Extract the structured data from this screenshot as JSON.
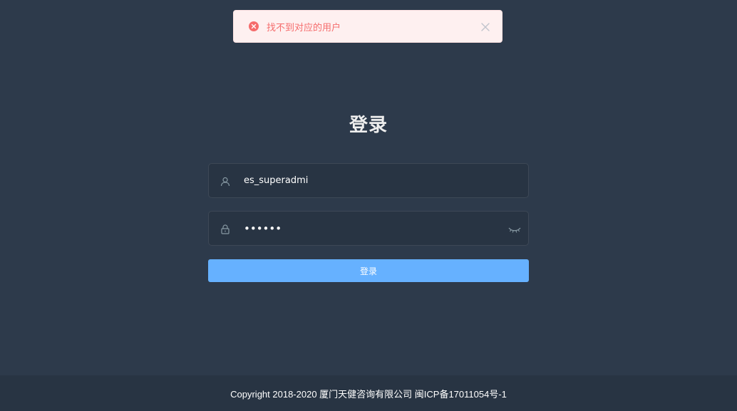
{
  "toast": {
    "type": "error",
    "message": "找不到对应的用户",
    "icon": "error-circle-icon",
    "close_icon": "close-icon"
  },
  "login": {
    "title": "登录",
    "username": {
      "value": "es_superadmi",
      "icon": "user-icon"
    },
    "password": {
      "value": "••••••",
      "icon": "lock-icon",
      "toggle_icon": "eye-closed-icon"
    },
    "submit_label": "登录"
  },
  "footer": {
    "text": "Copyright 2018-2020 厦门天健咨询有限公司 闽ICP备17011054号-1"
  },
  "colors": {
    "background": "#2d3a4b",
    "input_bg": "#283443",
    "button": "#66b1ff",
    "error": "#f56c6c",
    "toast_bg": "#fef0f0"
  }
}
